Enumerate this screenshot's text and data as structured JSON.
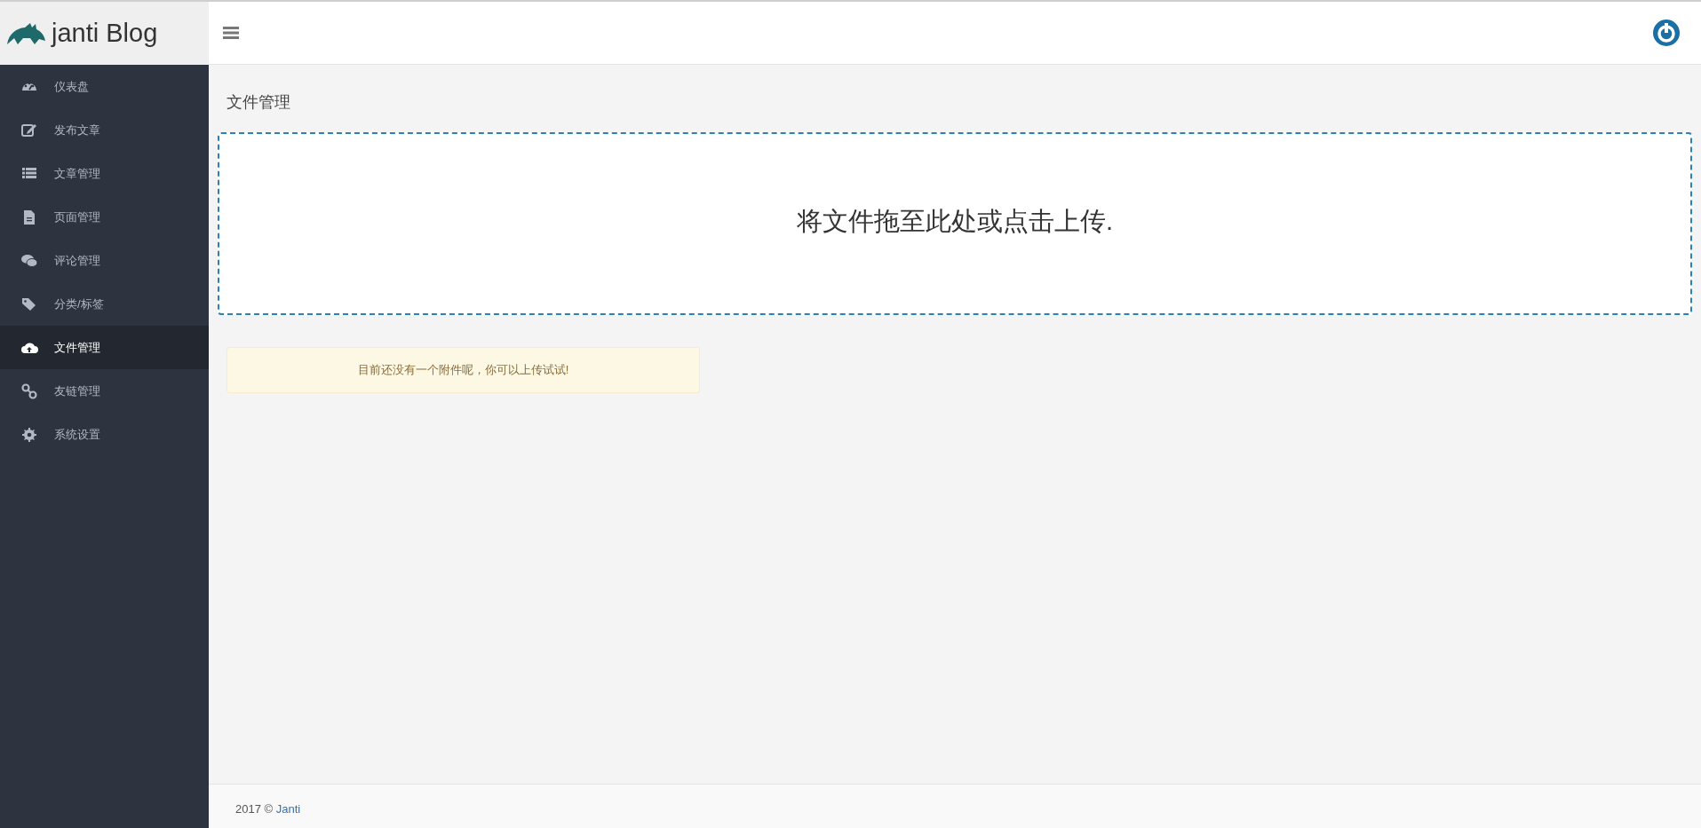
{
  "brand": {
    "title": "janti Blog"
  },
  "sidebar": {
    "items": [
      {
        "label": "仪表盘",
        "selected": false
      },
      {
        "label": "发布文章",
        "selected": false
      },
      {
        "label": "文章管理",
        "selected": false
      },
      {
        "label": "页面管理",
        "selected": false
      },
      {
        "label": "评论管理",
        "selected": false
      },
      {
        "label": "分类/标签",
        "selected": false
      },
      {
        "label": "文件管理",
        "selected": true
      },
      {
        "label": "友链管理",
        "selected": false
      },
      {
        "label": "系统设置",
        "selected": false
      }
    ]
  },
  "page_title": "文件管理",
  "dropzone": {
    "message": "将文件拖至此处或点击上传."
  },
  "alert": {
    "message": "目前还没有一个附件呢，你可以上传试试!"
  },
  "footer": {
    "text": "2017 ©",
    "link": "Janti"
  }
}
